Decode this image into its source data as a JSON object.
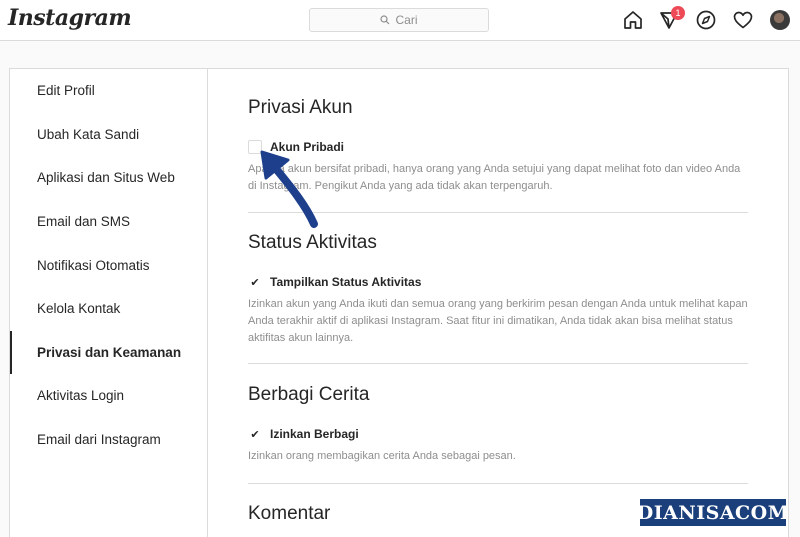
{
  "header": {
    "logo": "Instagram",
    "search_placeholder": "Cari",
    "notification_count": "1",
    "icons": [
      "home-icon",
      "direct-icon",
      "explore-icon",
      "heart-icon",
      "avatar"
    ]
  },
  "sidebar": {
    "items": [
      {
        "label": "Edit Profil"
      },
      {
        "label": "Ubah Kata Sandi"
      },
      {
        "label": "Aplikasi dan Situs Web"
      },
      {
        "label": "Email dan SMS"
      },
      {
        "label": "Notifikasi Otomatis"
      },
      {
        "label": "Kelola Kontak"
      },
      {
        "label": "Privasi dan Keamanan",
        "active": true
      },
      {
        "label": "Aktivitas Login"
      },
      {
        "label": "Email dari Instagram"
      }
    ]
  },
  "sections": [
    {
      "title": "Privasi Akun",
      "checkbox_label": "Akun Pribadi",
      "checked": false,
      "description": "Apabila akun bersifat pribadi, hanya orang yang Anda setujui yang dapat melihat foto dan video Anda di Instagram. Pengikut Anda yang ada tidak akan terpengaruh."
    },
    {
      "title": "Status Aktivitas",
      "checkbox_label": "Tampilkan Status Aktivitas",
      "checked": true,
      "description": "Izinkan akun yang Anda ikuti dan semua orang yang berkirim pesan dengan Anda untuk melihat kapan Anda terakhir aktif di aplikasi Instagram. Saat fitur ini dimatikan, Anda tidak akan bisa melihat status aktifitas akun lainnya."
    },
    {
      "title": "Berbagi Cerita",
      "checkbox_label": "Izinkan Berbagi",
      "checked": true,
      "description": "Izinkan orang membagikan cerita Anda sebagai pesan."
    },
    {
      "title": "Komentar"
    }
  ],
  "watermark": "DIANISACOM",
  "colors": {
    "border": "#dbdbdb",
    "text": "#262626",
    "muted": "#8e8e8e",
    "badge": "#ed4956",
    "arrow": "#1e3f8c",
    "watermark_bg": "#1a3f7a"
  }
}
